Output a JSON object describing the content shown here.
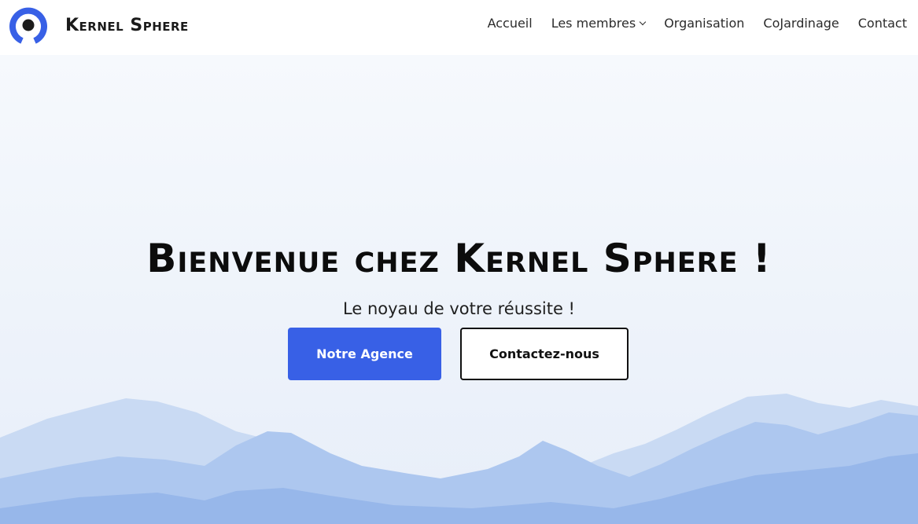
{
  "header": {
    "brand": "Kernel Sphere",
    "logo_icon": "ring-logo-icon",
    "accent_color": "#3860e6",
    "nav": [
      {
        "label": "Accueil"
      },
      {
        "label": "Les membres",
        "has_dropdown": true
      },
      {
        "label": "Organisation"
      },
      {
        "label": "CoJardinage"
      },
      {
        "label": "Contact"
      }
    ]
  },
  "hero": {
    "title": "Bienvenue chez Kernel Sphere !",
    "subtitle": "Le noyau de votre réussite !",
    "primary_button": "Notre Agence",
    "secondary_button": "Contactez-nous",
    "primary_color": "#3860e6",
    "background_image": "misty-blue-mountains"
  }
}
